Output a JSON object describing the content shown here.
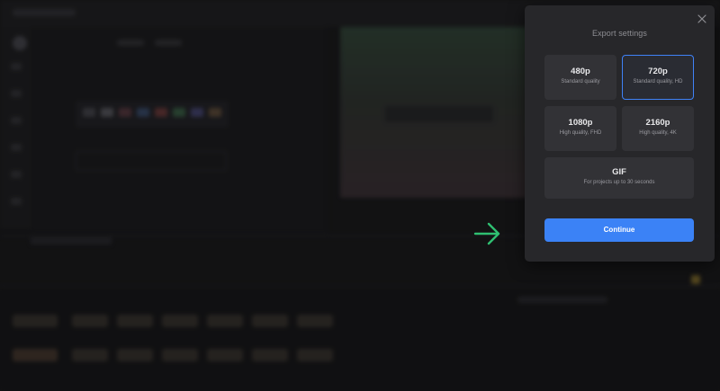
{
  "modal": {
    "title": "Export settings",
    "close_icon": "close-icon",
    "options": [
      {
        "name": "480p",
        "desc": "Standard quality",
        "selected": false
      },
      {
        "name": "720p",
        "desc": "Standard quality, HD",
        "selected": true
      },
      {
        "name": "1080p",
        "desc": "High quality, FHD",
        "selected": false
      },
      {
        "name": "2160p",
        "desc": "High quality, 4K",
        "selected": false
      },
      {
        "name": "GIF",
        "desc": "For projects up to 30 seconds",
        "selected": false
      }
    ],
    "continue_label": "Continue"
  },
  "annotation": {
    "icon": "arrow-right-icon",
    "color": "#2fbf71"
  },
  "colors": {
    "accent": "#3b82f6",
    "modal_bg": "#27272a",
    "option_bg": "#323236",
    "page_bg": "#141416"
  }
}
